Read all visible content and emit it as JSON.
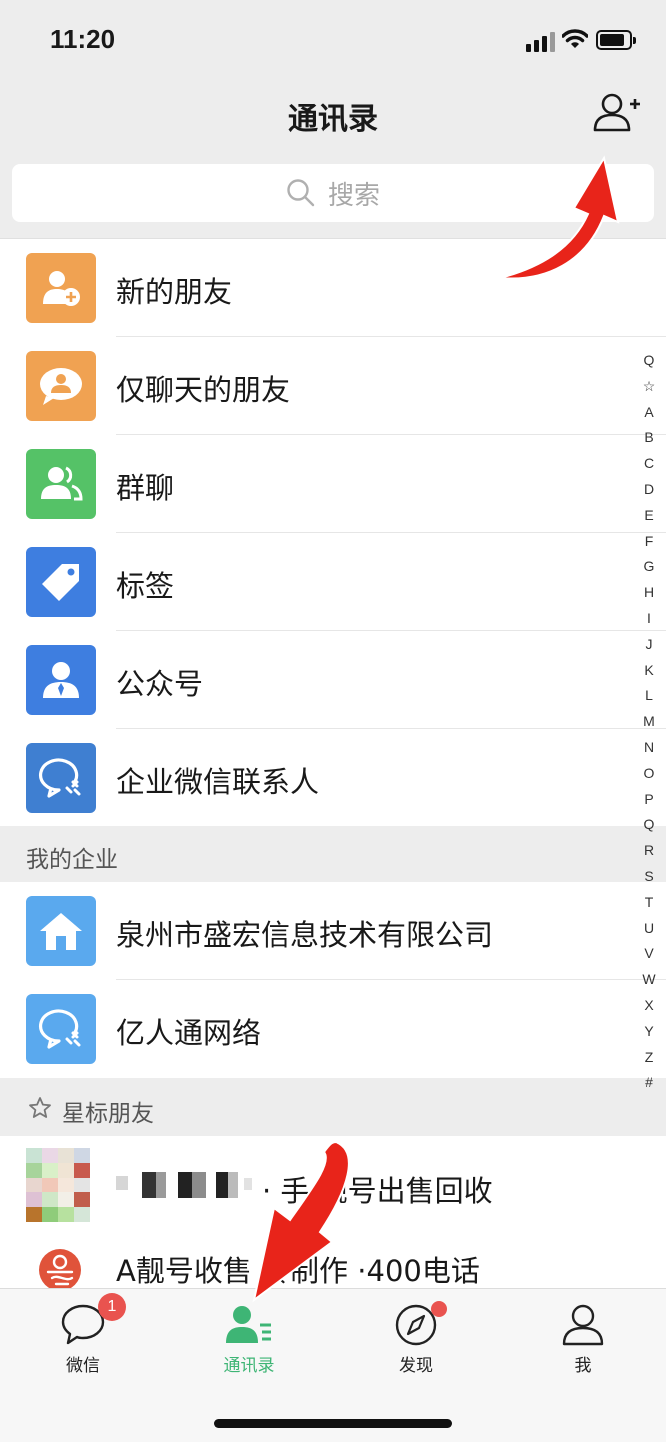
{
  "status": {
    "time": "11:20"
  },
  "nav": {
    "title": "通讯录"
  },
  "search": {
    "placeholder": "搜索"
  },
  "top_items": [
    {
      "label": "新的朋友",
      "color": "#f0a252",
      "icon": "add-friend-icon"
    },
    {
      "label": "仅聊天的朋友",
      "color": "#f0a252",
      "icon": "chat-only-icon"
    },
    {
      "label": "群聊",
      "color": "#55c267",
      "icon": "group-chat-icon"
    },
    {
      "label": "标签",
      "color": "#3e7ee0",
      "icon": "tag-icon"
    },
    {
      "label": "公众号",
      "color": "#3e7ee0",
      "icon": "official-account-icon"
    },
    {
      "label": "企业微信联系人",
      "color": "#3f7fd1",
      "icon": "wecom-icon"
    }
  ],
  "enterprise": {
    "header": "我的企业",
    "items": [
      {
        "label": "泉州市盛宏信息技术有限公司",
        "color": "#5aa9ee",
        "icon": "house-icon"
      },
      {
        "label": "亿人通网络",
        "color": "#5aa9ee",
        "icon": "wecom-icon"
      }
    ]
  },
  "starred": {
    "header": "星标朋友",
    "items": [
      {
        "label": "· 手    靓号出售回收"
      },
      {
        "label": "A靓号收售    铃制作 ·400电话"
      }
    ]
  },
  "index": [
    "Q",
    "☆",
    "A",
    "B",
    "C",
    "D",
    "E",
    "F",
    "G",
    "H",
    "I",
    "J",
    "K",
    "L",
    "M",
    "N",
    "O",
    "P",
    "Q",
    "R",
    "S",
    "T",
    "U",
    "V",
    "W",
    "X",
    "Y",
    "Z",
    "#"
  ],
  "tabs": [
    {
      "label": "微信",
      "badge": "1"
    },
    {
      "label": "通讯录"
    },
    {
      "label": "发现"
    },
    {
      "label": "我"
    }
  ],
  "colors": {
    "accent": "#3eb575",
    "badge": "#e9534f",
    "annotation_arrow": "#e8241a"
  }
}
